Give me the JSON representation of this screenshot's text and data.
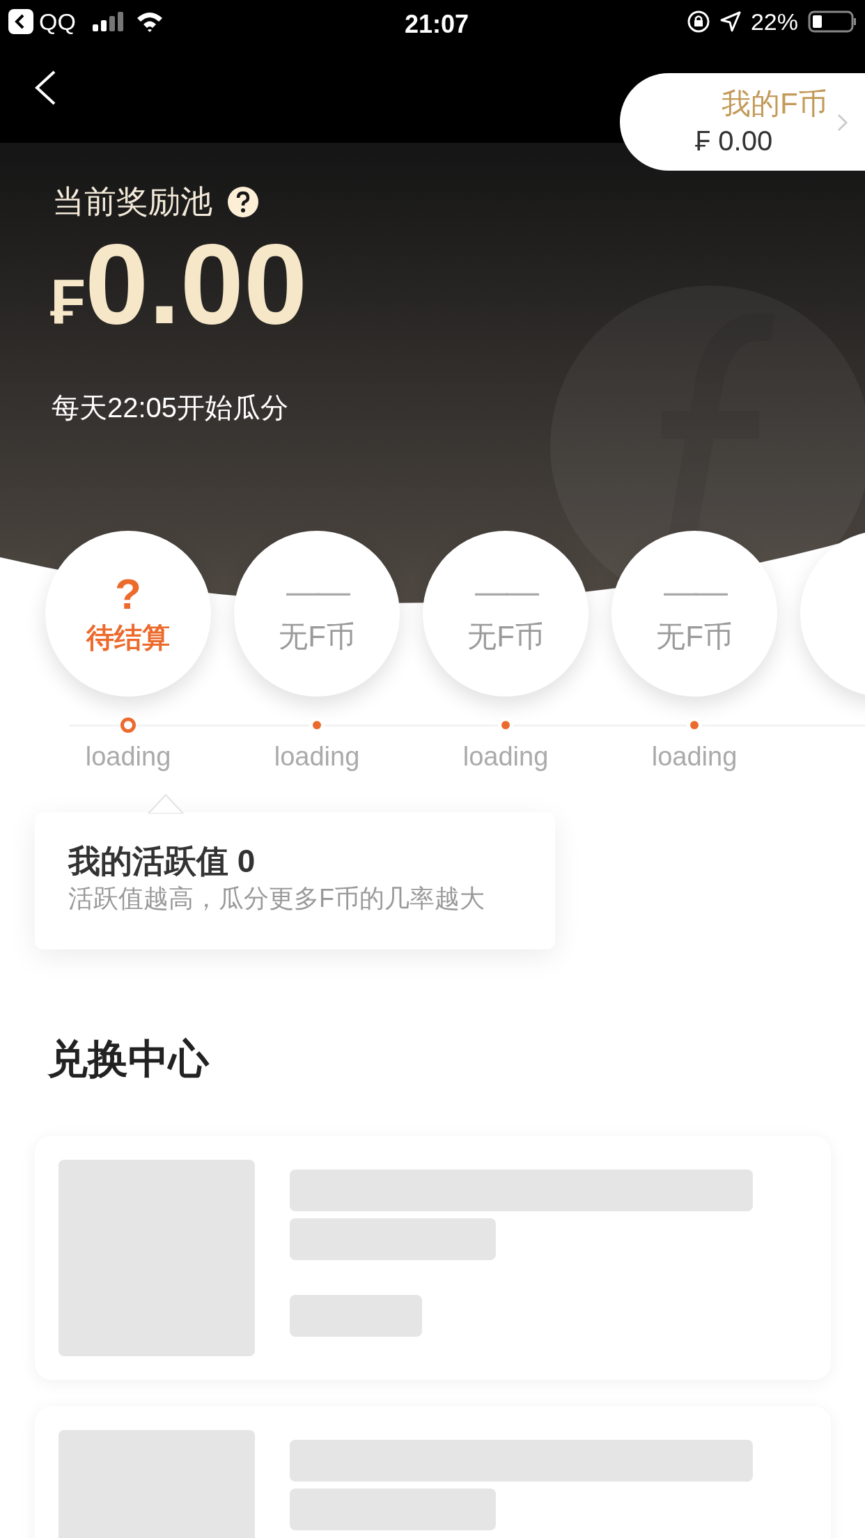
{
  "status_bar": {
    "back_app": "QQ",
    "time": "21:07",
    "battery": "22%"
  },
  "wallet": {
    "label": "我的F币",
    "amount": "₣ 0.00"
  },
  "pool": {
    "title": "当前奖励池",
    "symbol": "₣",
    "amount": "0.00",
    "schedule": "每天22:05开始瓜分"
  },
  "rounds": [
    {
      "kind": "pending",
      "mark": "?",
      "status": "待结算",
      "label": "loading",
      "selected": true
    },
    {
      "kind": "empty",
      "mark": "——",
      "status": "无F币",
      "label": "loading",
      "selected": false
    },
    {
      "kind": "empty",
      "mark": "——",
      "status": "无F币",
      "label": "loading",
      "selected": false
    },
    {
      "kind": "empty",
      "mark": "——",
      "status": "无F币",
      "label": "loading",
      "selected": false
    },
    {
      "kind": "cut_off"
    }
  ],
  "activity": {
    "title": "我的活跃值 0",
    "hint": "活跃值越高，瓜分更多F币的几率越大"
  },
  "exchange_center": {
    "title": "兑换中心",
    "items": [
      {
        "kind": "skeleton"
      },
      {
        "kind": "skeleton_cut"
      }
    ]
  }
}
